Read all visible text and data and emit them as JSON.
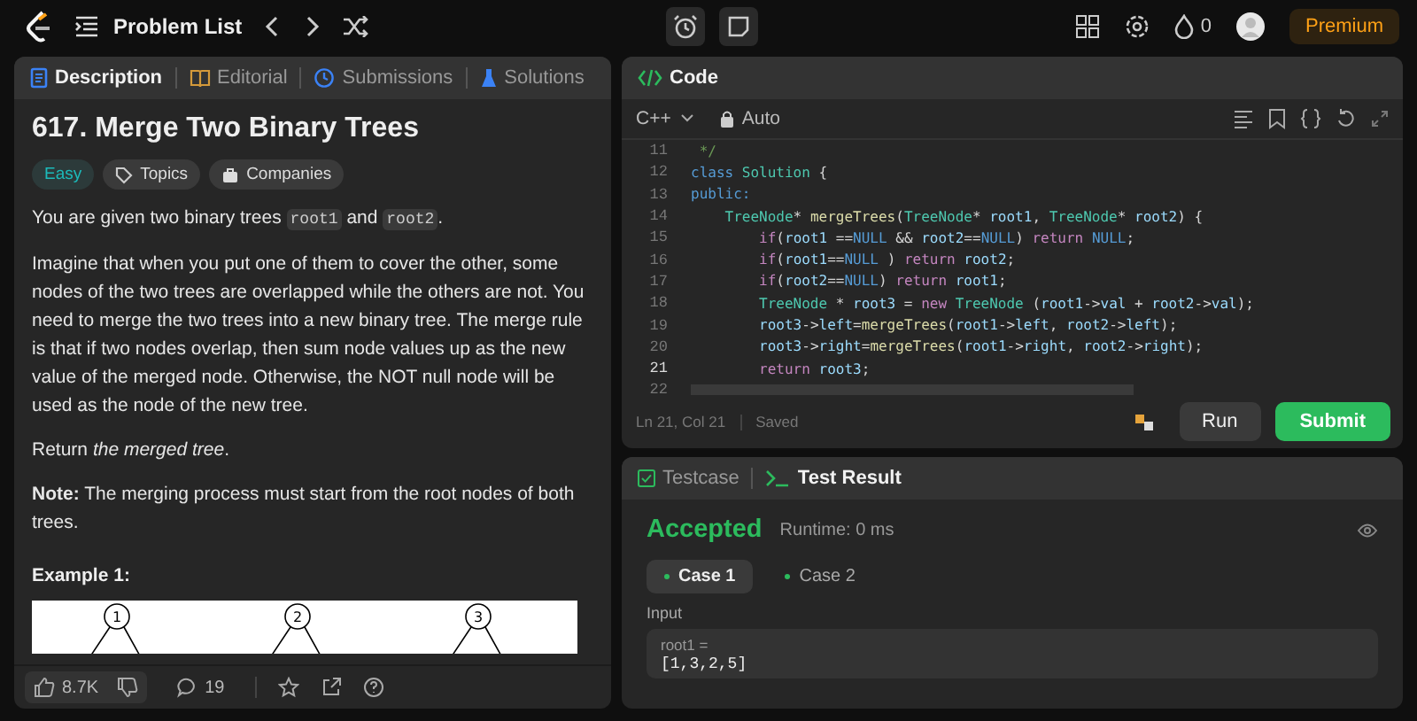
{
  "topbar": {
    "title": "Problem List",
    "streak": "0",
    "premium": "Premium"
  },
  "left_tabs": [
    {
      "label": "Description",
      "selected": true
    },
    {
      "label": "Editorial",
      "selected": false
    },
    {
      "label": "Submissions",
      "selected": false
    },
    {
      "label": "Solutions",
      "selected": false
    }
  ],
  "problem": {
    "title": "617. Merge Two Binary Trees",
    "tags": [
      {
        "label": "Easy",
        "kind": "difficulty"
      },
      {
        "label": "Topics",
        "kind": "topics"
      },
      {
        "label": "Companies",
        "kind": "companies"
      }
    ],
    "paragraphs": [
      [
        {
          "text": "You are given two binary trees ",
          "kind": "text"
        },
        {
          "text": "root1",
          "kind": "code"
        },
        {
          "text": " and ",
          "kind": "text"
        },
        {
          "text": "root2",
          "kind": "code"
        },
        {
          "text": ".",
          "kind": "text"
        }
      ],
      [
        {
          "text": "Imagine that when you put one of them to cover the other, some nodes of the two trees are overlapped while the others are not. You need to merge the two trees into a new binary tree. The merge rule is that if two nodes overlap, then sum node values up as the new value of the merged node. Otherwise, the NOT null node will be used as the node of the new tree.",
          "kind": "text"
        }
      ],
      [
        {
          "text": "Return *the merged tree*.",
          "kind": "text"
        }
      ],
      [
        {
          "text": "**Note:** The merging process must start from the root nodes of both trees.",
          "kind": "text"
        }
      ]
    ],
    "example_title": "Example 1:",
    "example_nodes": [
      "1",
      "2",
      "3"
    ]
  },
  "left_footer": {
    "likes": "8.7K",
    "comments": "19"
  },
  "code_tab": "Code",
  "editor": {
    "language": "C++",
    "mode": "Auto",
    "status": "Ln 21, Col 21",
    "saved": "Saved",
    "lines": [
      {
        "number": "11",
        "active": false,
        "tokens": [
          {
            "text": " */",
            "kind": "comment"
          }
        ]
      },
      {
        "number": "12",
        "active": false,
        "tokens": [
          {
            "text": "class",
            "kind": "decl"
          },
          {
            "text": " Solution",
            "kind": "type"
          },
          {
            "text": " {",
            "kind": "plain"
          }
        ]
      },
      {
        "number": "13",
        "active": false,
        "tokens": [
          {
            "text": "public:",
            "kind": "decl"
          }
        ]
      },
      {
        "number": "14",
        "active": false,
        "tokens": [
          {
            "text": "    TreeNode",
            "kind": "type"
          },
          {
            "text": "* ",
            "kind": "plain"
          },
          {
            "text": "mergeTrees",
            "kind": "fn"
          },
          {
            "text": "(",
            "kind": "plain"
          },
          {
            "text": "TreeNode",
            "kind": "type"
          },
          {
            "text": "* ",
            "kind": "plain"
          },
          {
            "text": "root1",
            "kind": "var"
          },
          {
            "text": ", ",
            "kind": "plain"
          },
          {
            "text": "TreeNode",
            "kind": "type"
          },
          {
            "text": "* ",
            "kind": "plain"
          },
          {
            "text": "root2",
            "kind": "var"
          },
          {
            "text": ") {",
            "kind": "plain"
          }
        ]
      },
      {
        "number": "15",
        "active": false,
        "tokens": [
          {
            "text": "        if",
            "kind": "kw"
          },
          {
            "text": "(",
            "kind": "plain"
          },
          {
            "text": "root1",
            "kind": "var"
          },
          {
            "text": " ==",
            "kind": "plain"
          },
          {
            "text": "NULL",
            "kind": "decl"
          },
          {
            "text": " && ",
            "kind": "plain"
          },
          {
            "text": "root2",
            "kind": "var"
          },
          {
            "text": "==",
            "kind": "plain"
          },
          {
            "text": "NULL",
            "kind": "decl"
          },
          {
            "text": ") ",
            "kind": "plain"
          },
          {
            "text": "return",
            "kind": "kw"
          },
          {
            "text": " NULL",
            "kind": "decl"
          },
          {
            "text": ";",
            "kind": "plain"
          }
        ]
      },
      {
        "number": "16",
        "active": false,
        "tokens": [
          {
            "text": "        if",
            "kind": "kw"
          },
          {
            "text": "(",
            "kind": "plain"
          },
          {
            "text": "root1",
            "kind": "var"
          },
          {
            "text": "==",
            "kind": "plain"
          },
          {
            "text": "NULL",
            "kind": "decl"
          },
          {
            "text": " ) ",
            "kind": "plain"
          },
          {
            "text": "return",
            "kind": "kw"
          },
          {
            "text": " root2",
            "kind": "var"
          },
          {
            "text": ";",
            "kind": "plain"
          }
        ]
      },
      {
        "number": "17",
        "active": false,
        "tokens": [
          {
            "text": "        if",
            "kind": "kw"
          },
          {
            "text": "(",
            "kind": "plain"
          },
          {
            "text": "root2",
            "kind": "var"
          },
          {
            "text": "==",
            "kind": "plain"
          },
          {
            "text": "NULL",
            "kind": "decl"
          },
          {
            "text": ") ",
            "kind": "plain"
          },
          {
            "text": "return",
            "kind": "kw"
          },
          {
            "text": " root1",
            "kind": "var"
          },
          {
            "text": ";",
            "kind": "plain"
          }
        ]
      },
      {
        "number": "18",
        "active": false,
        "tokens": [
          {
            "text": "        TreeNode",
            "kind": "type"
          },
          {
            "text": " * ",
            "kind": "plain"
          },
          {
            "text": "root3",
            "kind": "var"
          },
          {
            "text": " = ",
            "kind": "plain"
          },
          {
            "text": "new",
            "kind": "kw"
          },
          {
            "text": " TreeNode",
            "kind": "type"
          },
          {
            "text": " (",
            "kind": "plain"
          },
          {
            "text": "root1",
            "kind": "var"
          },
          {
            "text": "->",
            "kind": "plain"
          },
          {
            "text": "val",
            "kind": "var"
          },
          {
            "text": " + ",
            "kind": "plain"
          },
          {
            "text": "root2",
            "kind": "var"
          },
          {
            "text": "->",
            "kind": "plain"
          },
          {
            "text": "val",
            "kind": "var"
          },
          {
            "text": ");",
            "kind": "plain"
          }
        ]
      },
      {
        "number": "19",
        "active": false,
        "tokens": [
          {
            "text": "        root3",
            "kind": "var"
          },
          {
            "text": "->",
            "kind": "plain"
          },
          {
            "text": "left",
            "kind": "var"
          },
          {
            "text": "=",
            "kind": "plain"
          },
          {
            "text": "mergeTrees",
            "kind": "fn"
          },
          {
            "text": "(",
            "kind": "plain"
          },
          {
            "text": "root1",
            "kind": "var"
          },
          {
            "text": "->",
            "kind": "plain"
          },
          {
            "text": "left",
            "kind": "var"
          },
          {
            "text": ", ",
            "kind": "plain"
          },
          {
            "text": "root2",
            "kind": "var"
          },
          {
            "text": "->",
            "kind": "plain"
          },
          {
            "text": "left",
            "kind": "var"
          },
          {
            "text": ");",
            "kind": "plain"
          }
        ]
      },
      {
        "number": "20",
        "active": false,
        "tokens": [
          {
            "text": "        root3",
            "kind": "var"
          },
          {
            "text": "->",
            "kind": "plain"
          },
          {
            "text": "right",
            "kind": "var"
          },
          {
            "text": "=",
            "kind": "plain"
          },
          {
            "text": "mergeTrees",
            "kind": "fn"
          },
          {
            "text": "(",
            "kind": "plain"
          },
          {
            "text": "root1",
            "kind": "var"
          },
          {
            "text": "->",
            "kind": "plain"
          },
          {
            "text": "right",
            "kind": "var"
          },
          {
            "text": ", ",
            "kind": "plain"
          },
          {
            "text": "root2",
            "kind": "var"
          },
          {
            "text": "->",
            "kind": "plain"
          },
          {
            "text": "right",
            "kind": "var"
          },
          {
            "text": ");",
            "kind": "plain"
          }
        ]
      },
      {
        "number": "21",
        "active": true,
        "tokens": [
          {
            "text": "        return",
            "kind": "kw"
          },
          {
            "text": " root3",
            "kind": "var"
          },
          {
            "text": ";",
            "kind": "plain"
          }
        ]
      },
      {
        "number": "22",
        "active": false
      }
    ]
  },
  "actions": {
    "run": "Run",
    "submit": "Submit"
  },
  "bottom_tabs": [
    {
      "label": "Testcase",
      "selected": false
    },
    {
      "label": "Test Result",
      "selected": true
    }
  ],
  "result": {
    "verdict": "Accepted",
    "runtime": "Runtime: 0 ms",
    "cases": [
      {
        "label": "Case 1",
        "selected": true
      },
      {
        "label": "Case 2",
        "selected": false
      }
    ],
    "input_label": "Input",
    "param": "root1 =",
    "value": "[1,3,2,5]"
  }
}
